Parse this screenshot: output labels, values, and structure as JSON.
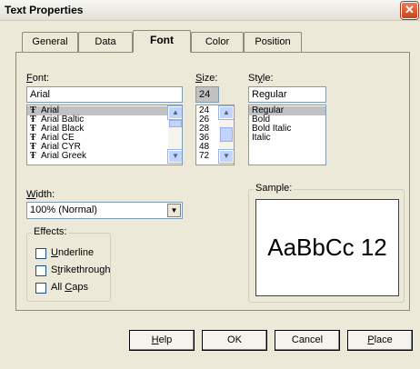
{
  "window": {
    "title": "Text Properties",
    "close_glyph": "✕"
  },
  "tabs": [
    {
      "label": "General"
    },
    {
      "label": "Data"
    },
    {
      "label": "Font"
    },
    {
      "label": "Color"
    },
    {
      "label": "Position"
    }
  ],
  "font": {
    "label_mnemonic": "F",
    "label_rest": "ont:",
    "value": "Arial",
    "items": [
      "Arial",
      "Arial Baltic",
      "Arial Black",
      "Arial CE",
      "Arial CYR",
      "Arial Greek"
    ],
    "selected_index": 0,
    "item_icon": "Ŧ"
  },
  "size": {
    "label_mnemonic": "S",
    "label_rest": "ize:",
    "value": "24",
    "items": [
      "24",
      "26",
      "28",
      "36",
      "48",
      "72"
    ]
  },
  "style": {
    "label_pre": "St",
    "label_mnemonic": "y",
    "label_rest": "le:",
    "value": "Regular",
    "items": [
      "Regular",
      "Bold",
      "Bold Italic",
      "Italic"
    ],
    "selected_index": 0
  },
  "width": {
    "label_mnemonic": "W",
    "label_rest": "idth:",
    "value": "100% (Normal)"
  },
  "effects": {
    "title": "Effects:",
    "underline": {
      "mnemonic": "U",
      "rest": "nderline",
      "checked": false
    },
    "strikethrough": {
      "pre": "S",
      "mnemonic": "t",
      "rest": "rikethrough",
      "checked": false
    },
    "allcaps": {
      "pre": "All ",
      "mnemonic": "C",
      "rest": "aps",
      "checked": false
    }
  },
  "sample": {
    "title": "Sample:",
    "text": "AaBbCc 12"
  },
  "buttons": {
    "help": {
      "mnemonic": "H",
      "rest": "elp"
    },
    "ok": "OK",
    "cancel": "Cancel",
    "place": {
      "mnemonic": "P",
      "rest": "lace"
    }
  },
  "icons": {
    "scroll_up": "▲",
    "scroll_down": "▼",
    "dropdown": "▼"
  }
}
